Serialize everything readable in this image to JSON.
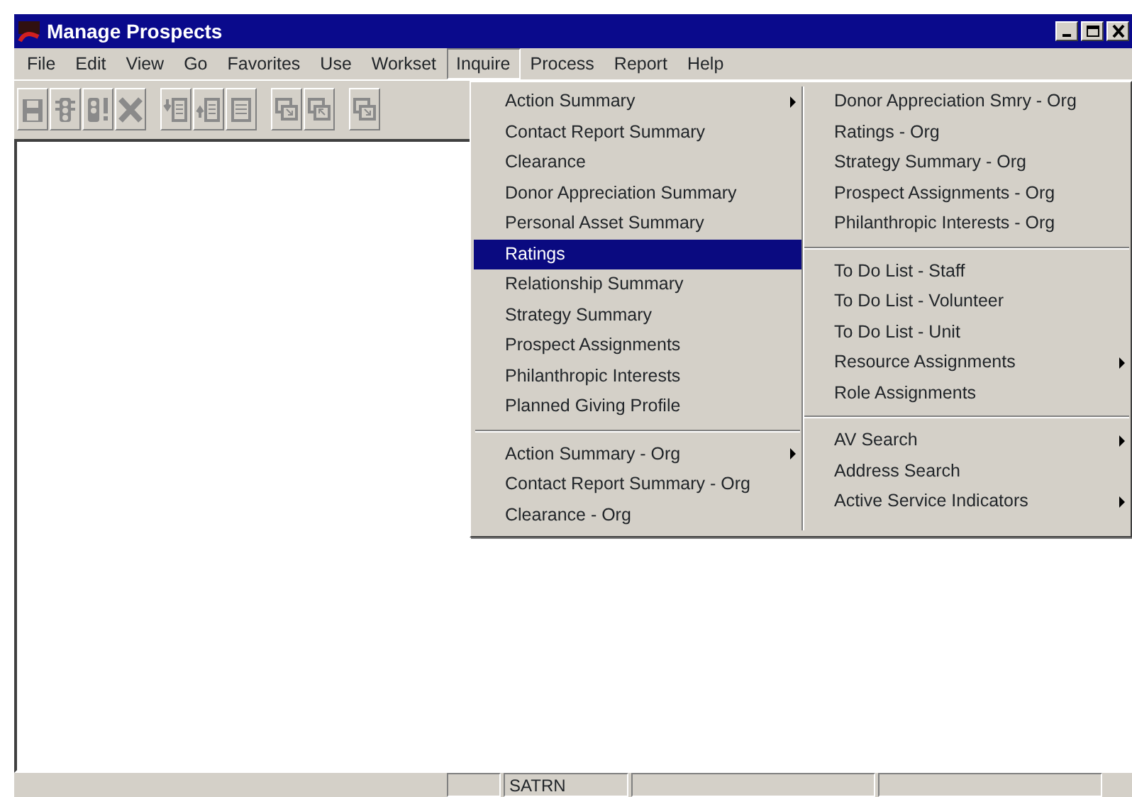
{
  "window": {
    "title": "Manage Prospects",
    "controls": [
      {
        "kind": "minimize"
      },
      {
        "kind": "maximize"
      },
      {
        "kind": "close"
      }
    ]
  },
  "menu_bar": [
    {
      "label": "File",
      "selected": false
    },
    {
      "label": "Edit",
      "selected": false
    },
    {
      "label": "View",
      "selected": false
    },
    {
      "label": "Go",
      "selected": false
    },
    {
      "label": "Favorites",
      "selected": false
    },
    {
      "label": "Use",
      "selected": false
    },
    {
      "label": "Workset",
      "selected": false
    },
    {
      "label": "Inquire",
      "selected": true
    },
    {
      "label": "Process",
      "selected": false
    },
    {
      "label": "Report",
      "selected": false
    },
    {
      "label": "Help",
      "selected": false
    }
  ],
  "toolbar": [
    {
      "kind": "save"
    },
    {
      "kind": "light"
    },
    {
      "kind": "light-alert"
    },
    {
      "kind": "delete"
    },
    {
      "kind": "sep"
    },
    {
      "kind": "insert-above"
    },
    {
      "kind": "insert-below"
    },
    {
      "kind": "list"
    },
    {
      "kind": "sep"
    },
    {
      "kind": "window-down"
    },
    {
      "kind": "window-up"
    },
    {
      "kind": "sep"
    },
    {
      "kind": "window-down"
    }
  ],
  "dropdown": {
    "columns": [
      [
        [
          {
            "label": "Action Summary",
            "submenu": true,
            "selected": false
          },
          {
            "label": "Contact Report Summary",
            "submenu": false,
            "selected": false
          },
          {
            "label": "Clearance",
            "submenu": false,
            "selected": false
          },
          {
            "label": "Donor Appreciation Summary",
            "submenu": false,
            "selected": false
          },
          {
            "label": "Personal Asset Summary",
            "submenu": false,
            "selected": false
          },
          {
            "label": "Ratings",
            "submenu": false,
            "selected": true
          },
          {
            "label": "Relationship Summary",
            "submenu": false,
            "selected": false
          },
          {
            "label": "Strategy Summary",
            "submenu": false,
            "selected": false
          },
          {
            "label": "Prospect Assignments",
            "submenu": false,
            "selected": false
          },
          {
            "label": "Philanthropic Interests",
            "submenu": false,
            "selected": false
          },
          {
            "label": "Planned Giving Profile",
            "submenu": false,
            "selected": false
          }
        ],
        [
          {
            "label": "Action Summary - Org",
            "submenu": true,
            "selected": false
          },
          {
            "label": "Contact Report Summary - Org",
            "submenu": false,
            "selected": false
          },
          {
            "label": "Clearance - Org",
            "submenu": false,
            "selected": false
          }
        ]
      ],
      [
        [
          {
            "label": "Donor Appreciation Smry - Org",
            "submenu": false,
            "selected": false
          },
          {
            "label": "Ratings - Org",
            "submenu": false,
            "selected": false
          },
          {
            "label": "Strategy Summary - Org",
            "submenu": false,
            "selected": false
          },
          {
            "label": "Prospect Assignments - Org",
            "submenu": false,
            "selected": false
          },
          {
            "label": "Philanthropic Interests - Org",
            "submenu": false,
            "selected": false
          }
        ],
        [
          {
            "label": "To Do List - Staff",
            "submenu": false,
            "selected": false
          },
          {
            "label": "To Do List - Volunteer",
            "submenu": false,
            "selected": false
          },
          {
            "label": "To Do List - Unit",
            "submenu": false,
            "selected": false
          },
          {
            "label": "Resource Assignments",
            "submenu": true,
            "selected": false
          },
          {
            "label": "Role Assignments",
            "submenu": false,
            "selected": false
          }
        ],
        [
          {
            "label": "AV Search",
            "submenu": true,
            "selected": false
          },
          {
            "label": "Address Search",
            "submenu": false,
            "selected": false
          },
          {
            "label": "Active Service Indicators",
            "submenu": true,
            "selected": false
          }
        ]
      ]
    ]
  },
  "status_bar": {
    "user": "SATRN"
  }
}
